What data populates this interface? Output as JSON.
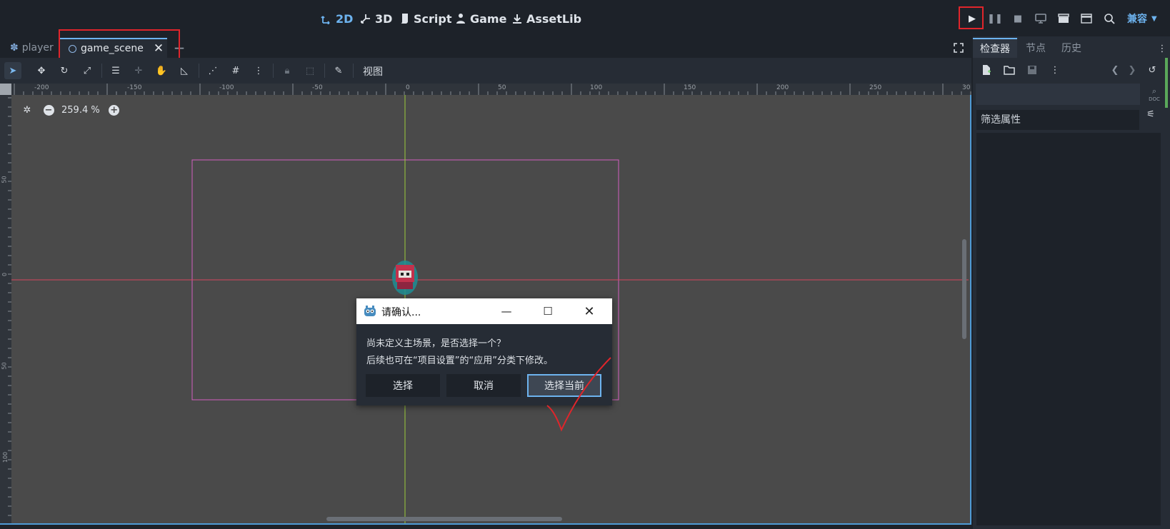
{
  "workspaces": [
    {
      "label": "2D",
      "icon": "2d-icon",
      "active": true
    },
    {
      "label": "3D",
      "icon": "3d-icon",
      "active": false
    },
    {
      "label": "Script",
      "icon": "script-icon",
      "active": false
    },
    {
      "label": "Game",
      "icon": "game-icon",
      "active": false
    },
    {
      "label": "AssetLib",
      "icon": "assetlib-icon",
      "active": false
    }
  ],
  "renderer": "兼容",
  "scene_tabs": [
    {
      "label": "player",
      "icon": "player-icon",
      "active": false
    },
    {
      "label": "game_scene",
      "icon": "node2d-icon",
      "active": true
    }
  ],
  "toolbar": {
    "view_label": "视图"
  },
  "ruler": {
    "top_ticks": [
      "-200",
      "-150",
      "-100",
      "-50",
      "0",
      "50",
      "100",
      "150",
      "200",
      "250",
      "30"
    ],
    "left_ticks": [
      "50",
      "0",
      "50",
      "100"
    ]
  },
  "zoom": {
    "level_text": "259.4 %"
  },
  "dock": {
    "tabs": [
      {
        "label": "检查器",
        "active": true
      },
      {
        "label": "节点",
        "active": false
      },
      {
        "label": "历史",
        "active": false
      }
    ],
    "filter_placeholder": "筛选属性",
    "doc_label": "DOC"
  },
  "dialog": {
    "title": "请确认...",
    "message_line1": "尚未定义主场景，是否选择一个？",
    "message_line2": "后续也可在“项目设置”的“应用”分类下修改。",
    "buttons": {
      "select": "选择",
      "cancel": "取消",
      "select_current": "选择当前"
    }
  },
  "colors": {
    "accent": "#6db3ef",
    "highlight_red": "#e0252b",
    "viewport_bg": "#4a4a4a",
    "scene_rect": "#d35fc0",
    "axis_x": "#d7455e",
    "axis_y": "#9ccc3a"
  }
}
